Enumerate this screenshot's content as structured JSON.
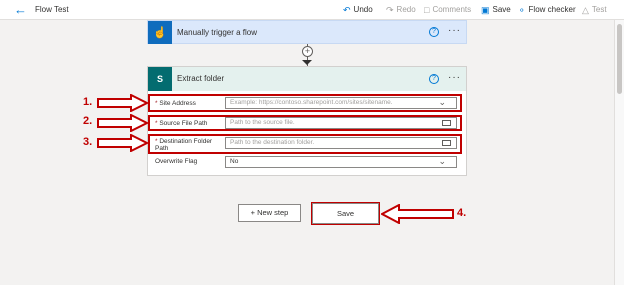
{
  "header": {
    "back_icon": "arrow-left-icon",
    "title": "Flow Test",
    "commands": [
      {
        "label": "Undo",
        "icon": "undo-icon",
        "enabled": true
      },
      {
        "label": "Redo",
        "icon": "redo-icon",
        "enabled": false
      },
      {
        "label": "Comments",
        "icon": "comment-icon",
        "enabled": false
      },
      {
        "label": "Save",
        "icon": "save-icon",
        "enabled": true
      },
      {
        "label": "Flow checker",
        "icon": "stethoscope-icon",
        "enabled": true
      },
      {
        "label": "Test",
        "icon": "flask-icon",
        "enabled": false
      }
    ]
  },
  "trigger_card": {
    "title": "Manually trigger a flow",
    "icon": "hand-tap-icon",
    "help": "?",
    "more": "···"
  },
  "connector": {
    "plus": "+"
  },
  "extract_card": {
    "title": "Extract folder",
    "icon": "sharepoint-icon",
    "icon_text": "S",
    "help": "?",
    "more": "···",
    "fields": {
      "site_address": {
        "required": "*",
        "label": "Site Address",
        "placeholder": "Example: https://contoso.sharepoint.com/sites/sitename."
      },
      "source_file_path": {
        "required": "*",
        "label": "Source File Path",
        "placeholder": "Path to the source file."
      },
      "destination_folder_path": {
        "required": "*",
        "label_line1": "Destination Folder",
        "label_line2": "Path",
        "placeholder": "Path to the destination folder."
      },
      "overwrite_flag": {
        "label": "Overwrite Flag",
        "value": "No"
      }
    }
  },
  "buttons": {
    "new_step": "+ New step",
    "save": "Save"
  },
  "annotations": {
    "n1": "1.",
    "n2": "2.",
    "n3": "3.",
    "n4": "4."
  },
  "colors": {
    "accent": "#0078d4",
    "trigger_bg": "#dbe8fb",
    "sharepoint": "#036c70",
    "annotation_red": "#c00000"
  }
}
